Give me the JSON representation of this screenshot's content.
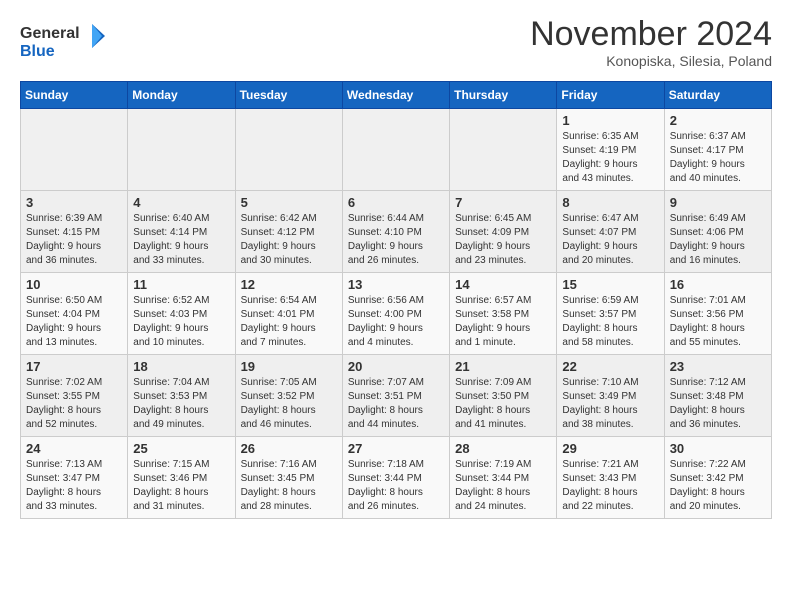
{
  "logo": {
    "general": "General",
    "blue": "Blue"
  },
  "header": {
    "month": "November 2024",
    "location": "Konopiska, Silesia, Poland"
  },
  "days_of_week": [
    "Sunday",
    "Monday",
    "Tuesday",
    "Wednesday",
    "Thursday",
    "Friday",
    "Saturday"
  ],
  "weeks": [
    [
      {
        "day": "",
        "info": ""
      },
      {
        "day": "",
        "info": ""
      },
      {
        "day": "",
        "info": ""
      },
      {
        "day": "",
        "info": ""
      },
      {
        "day": "",
        "info": ""
      },
      {
        "day": "1",
        "info": "Sunrise: 6:35 AM\nSunset: 4:19 PM\nDaylight: 9 hours\nand 43 minutes."
      },
      {
        "day": "2",
        "info": "Sunrise: 6:37 AM\nSunset: 4:17 PM\nDaylight: 9 hours\nand 40 minutes."
      }
    ],
    [
      {
        "day": "3",
        "info": "Sunrise: 6:39 AM\nSunset: 4:15 PM\nDaylight: 9 hours\nand 36 minutes."
      },
      {
        "day": "4",
        "info": "Sunrise: 6:40 AM\nSunset: 4:14 PM\nDaylight: 9 hours\nand 33 minutes."
      },
      {
        "day": "5",
        "info": "Sunrise: 6:42 AM\nSunset: 4:12 PM\nDaylight: 9 hours\nand 30 minutes."
      },
      {
        "day": "6",
        "info": "Sunrise: 6:44 AM\nSunset: 4:10 PM\nDaylight: 9 hours\nand 26 minutes."
      },
      {
        "day": "7",
        "info": "Sunrise: 6:45 AM\nSunset: 4:09 PM\nDaylight: 9 hours\nand 23 minutes."
      },
      {
        "day": "8",
        "info": "Sunrise: 6:47 AM\nSunset: 4:07 PM\nDaylight: 9 hours\nand 20 minutes."
      },
      {
        "day": "9",
        "info": "Sunrise: 6:49 AM\nSunset: 4:06 PM\nDaylight: 9 hours\nand 16 minutes."
      }
    ],
    [
      {
        "day": "10",
        "info": "Sunrise: 6:50 AM\nSunset: 4:04 PM\nDaylight: 9 hours\nand 13 minutes."
      },
      {
        "day": "11",
        "info": "Sunrise: 6:52 AM\nSunset: 4:03 PM\nDaylight: 9 hours\nand 10 minutes."
      },
      {
        "day": "12",
        "info": "Sunrise: 6:54 AM\nSunset: 4:01 PM\nDaylight: 9 hours\nand 7 minutes."
      },
      {
        "day": "13",
        "info": "Sunrise: 6:56 AM\nSunset: 4:00 PM\nDaylight: 9 hours\nand 4 minutes."
      },
      {
        "day": "14",
        "info": "Sunrise: 6:57 AM\nSunset: 3:58 PM\nDaylight: 9 hours\nand 1 minute."
      },
      {
        "day": "15",
        "info": "Sunrise: 6:59 AM\nSunset: 3:57 PM\nDaylight: 8 hours\nand 58 minutes."
      },
      {
        "day": "16",
        "info": "Sunrise: 7:01 AM\nSunset: 3:56 PM\nDaylight: 8 hours\nand 55 minutes."
      }
    ],
    [
      {
        "day": "17",
        "info": "Sunrise: 7:02 AM\nSunset: 3:55 PM\nDaylight: 8 hours\nand 52 minutes."
      },
      {
        "day": "18",
        "info": "Sunrise: 7:04 AM\nSunset: 3:53 PM\nDaylight: 8 hours\nand 49 minutes."
      },
      {
        "day": "19",
        "info": "Sunrise: 7:05 AM\nSunset: 3:52 PM\nDaylight: 8 hours\nand 46 minutes."
      },
      {
        "day": "20",
        "info": "Sunrise: 7:07 AM\nSunset: 3:51 PM\nDaylight: 8 hours\nand 44 minutes."
      },
      {
        "day": "21",
        "info": "Sunrise: 7:09 AM\nSunset: 3:50 PM\nDaylight: 8 hours\nand 41 minutes."
      },
      {
        "day": "22",
        "info": "Sunrise: 7:10 AM\nSunset: 3:49 PM\nDaylight: 8 hours\nand 38 minutes."
      },
      {
        "day": "23",
        "info": "Sunrise: 7:12 AM\nSunset: 3:48 PM\nDaylight: 8 hours\nand 36 minutes."
      }
    ],
    [
      {
        "day": "24",
        "info": "Sunrise: 7:13 AM\nSunset: 3:47 PM\nDaylight: 8 hours\nand 33 minutes."
      },
      {
        "day": "25",
        "info": "Sunrise: 7:15 AM\nSunset: 3:46 PM\nDaylight: 8 hours\nand 31 minutes."
      },
      {
        "day": "26",
        "info": "Sunrise: 7:16 AM\nSunset: 3:45 PM\nDaylight: 8 hours\nand 28 minutes."
      },
      {
        "day": "27",
        "info": "Sunrise: 7:18 AM\nSunset: 3:44 PM\nDaylight: 8 hours\nand 26 minutes."
      },
      {
        "day": "28",
        "info": "Sunrise: 7:19 AM\nSunset: 3:44 PM\nDaylight: 8 hours\nand 24 minutes."
      },
      {
        "day": "29",
        "info": "Sunrise: 7:21 AM\nSunset: 3:43 PM\nDaylight: 8 hours\nand 22 minutes."
      },
      {
        "day": "30",
        "info": "Sunrise: 7:22 AM\nSunset: 3:42 PM\nDaylight: 8 hours\nand 20 minutes."
      }
    ]
  ]
}
